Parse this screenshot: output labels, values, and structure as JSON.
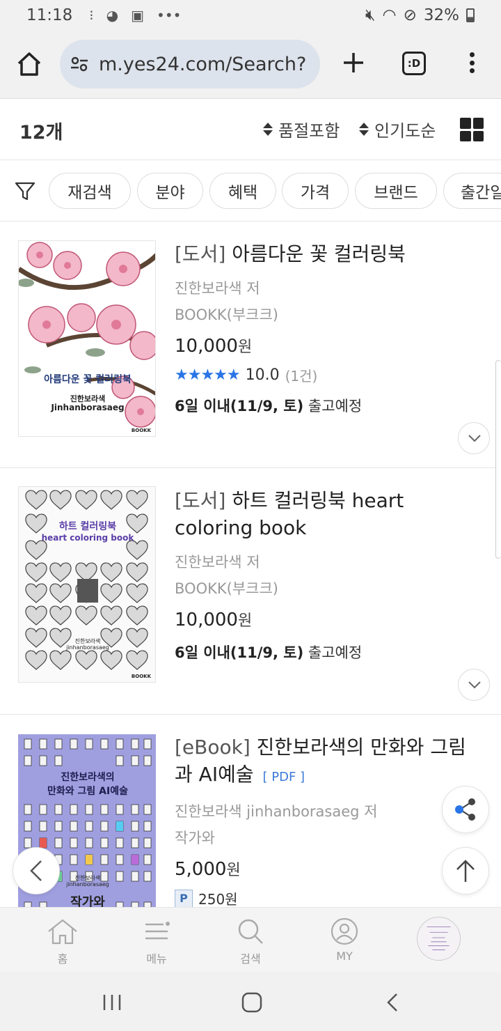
{
  "status_bar": {
    "time": "11:18",
    "battery": "32%"
  },
  "browser": {
    "url": "m.yes24.com/Search?",
    "tabs_label": ":D"
  },
  "results": {
    "count": "12개",
    "sort_filter": "품절포함",
    "sort_order": "인기도순"
  },
  "filters": [
    "재검색",
    "분야",
    "혜택",
    "가격",
    "브랜드",
    "출간일"
  ],
  "items": [
    {
      "category": "[도서]",
      "title": "아름다운 꽃 컬러링북",
      "author": "진한보라색 저",
      "publisher": "BOOKK(부크크)",
      "price": "10,000",
      "currency": "원",
      "rating": "10.0",
      "rating_count": "(1건)",
      "ship_bold": "6일 이내(11/9, 토)",
      "ship_rest": " 출고예정",
      "cover": {
        "title": "아름다운 꽃 컬러링북",
        "author_ko": "진한보라색",
        "author_en": "Jinhanborasaeg",
        "brand": "BOOKK"
      }
    },
    {
      "category": "[도서]",
      "title": "하트 컬러링북 heart coloring book",
      "author": "진한보라색 저",
      "publisher": "BOOKK(부크크)",
      "price": "10,000",
      "currency": "원",
      "ship_bold": "6일 이내(11/9, 토)",
      "ship_rest": " 출고예정",
      "cover": {
        "title_ko": "하트 컬러링북",
        "title_en": "heart coloring book",
        "author_ko": "진한보라색",
        "author_en": "jinhanborasaeg",
        "brand": "BOOKK"
      }
    },
    {
      "category": "[eBook]",
      "title": "진한보라색의 만화와 그림과 AI예술",
      "format": "[ PDF ]",
      "author": "진한보라색 jinhanborasaeg 저",
      "publisher": "작가와",
      "price": "5,000",
      "currency": "원",
      "points_badge": "P",
      "points": "250원",
      "cover": {
        "title_line1": "진한보라색의",
        "title_line2": "만화와 그림 AI예술",
        "author_ko": "진한보라색",
        "author_en": "jinhanborasaeg",
        "brand": "작가와"
      }
    }
  ],
  "bottom_nav": [
    {
      "label": "홈",
      "icon": "home-icon"
    },
    {
      "label": "메뉴",
      "icon": "menu-icon"
    },
    {
      "label": "검색",
      "icon": "search-icon"
    },
    {
      "label": "MY",
      "icon": "user-icon"
    }
  ],
  "colors": {
    "accent_blue": "#2a74e6",
    "url_bar": "#dde3ec",
    "cover3_bg": "#9f9fe0"
  }
}
